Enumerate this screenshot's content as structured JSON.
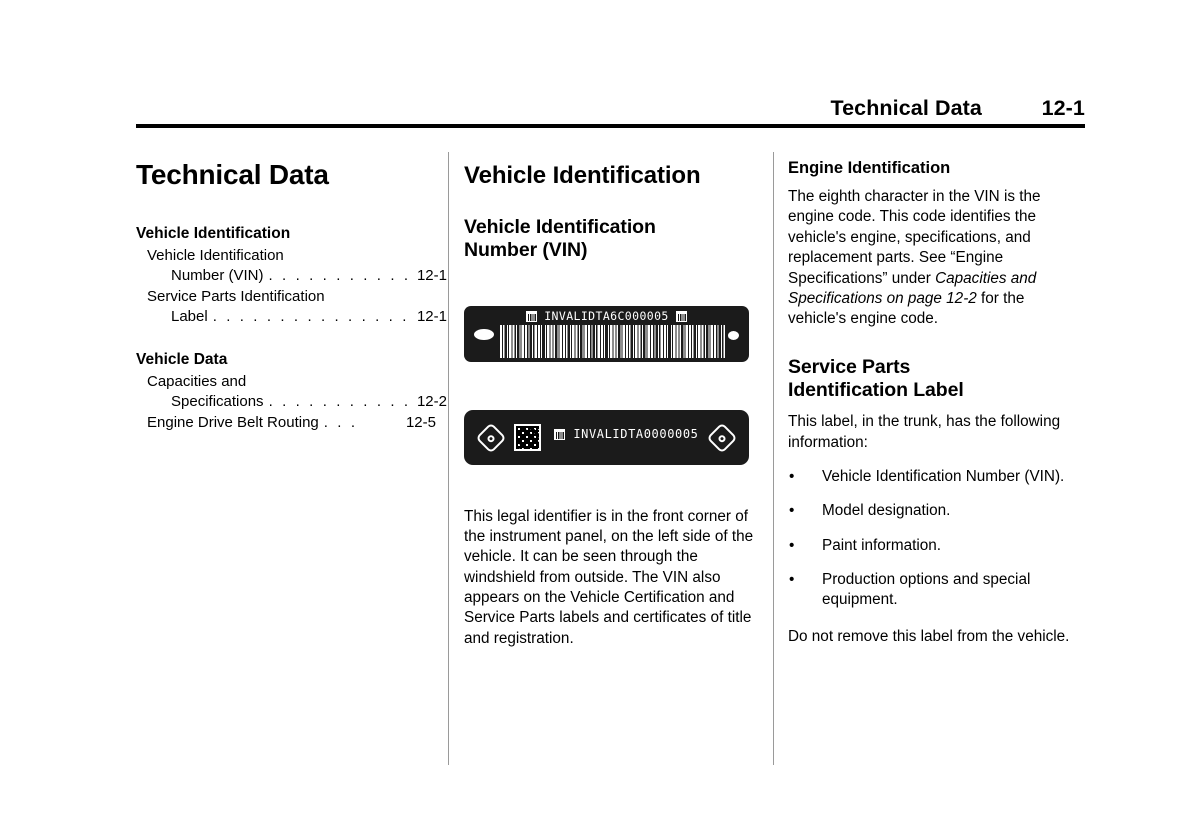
{
  "header": {
    "chapter_title": "Technical Data",
    "page_number": "12-1"
  },
  "toc": {
    "chapter_heading": "Technical Data",
    "groups": [
      {
        "title": "Vehicle Identification",
        "entries": [
          {
            "line1": "Vehicle Identification",
            "line2": "Number (VIN)",
            "dots": ". . . . . . . . . . . . .",
            "page": "12-1"
          },
          {
            "line1": "Service Parts Identification",
            "line2": "Label",
            "dots": ". . . . . . . . . . . . . . . . . . . . . .",
            "page": "12-1"
          }
        ]
      },
      {
        "title": "Vehicle Data",
        "entries": [
          {
            "line1": "Capacities and",
            "line2": "Specifications",
            "dots": ". . . . . . . . . . . . . .",
            "page": "12-2"
          },
          {
            "line1": "",
            "line2": "Engine Drive Belt Routing",
            "dots": ". . .",
            "page": "12-5"
          }
        ]
      }
    ]
  },
  "middle": {
    "heading": "Vehicle Identification",
    "subheading_line1": "Vehicle Identification",
    "subheading_line2": "Number (VIN)",
    "vin_plate": {
      "vin_text": "INVALIDTA6C000005",
      "alt": "vin-barcode-plate"
    },
    "vin_sticker": {
      "vin_text": "INVALIDTA0000005",
      "alt": "vin-label-sticker"
    },
    "body": "This legal identifier is in the front corner of the instrument panel, on the left side of the vehicle. It can be seen through the windshield from outside. The VIN also appears on the Vehicle Certification and Service Parts labels and certificates of title and registration."
  },
  "right": {
    "engine_heading": "Engine Identification",
    "engine_body_part1": "The eighth character in the VIN is the engine code. This code identifies the vehicle's engine, specifications, and replacement parts. See “Engine Specifications” under ",
    "engine_body_italic": "Capacities and Specifications on page 12-2",
    "engine_body_part2": " for the vehicle's engine code.",
    "service_heading_line1": "Service Parts",
    "service_heading_line2": "Identification Label",
    "service_intro": "This label, in the trunk, has the following information:",
    "bullet_marker": "•",
    "bullets": [
      "Vehicle Identification Number (VIN).",
      "Model designation.",
      "Paint information.",
      "Production options and special equipment."
    ],
    "service_outro": "Do not remove this label from the vehicle."
  },
  "colors": {
    "ink": "#000000",
    "paper": "#ffffff",
    "label_background": "#1b1b1b",
    "divider": "#9a9a9a"
  }
}
